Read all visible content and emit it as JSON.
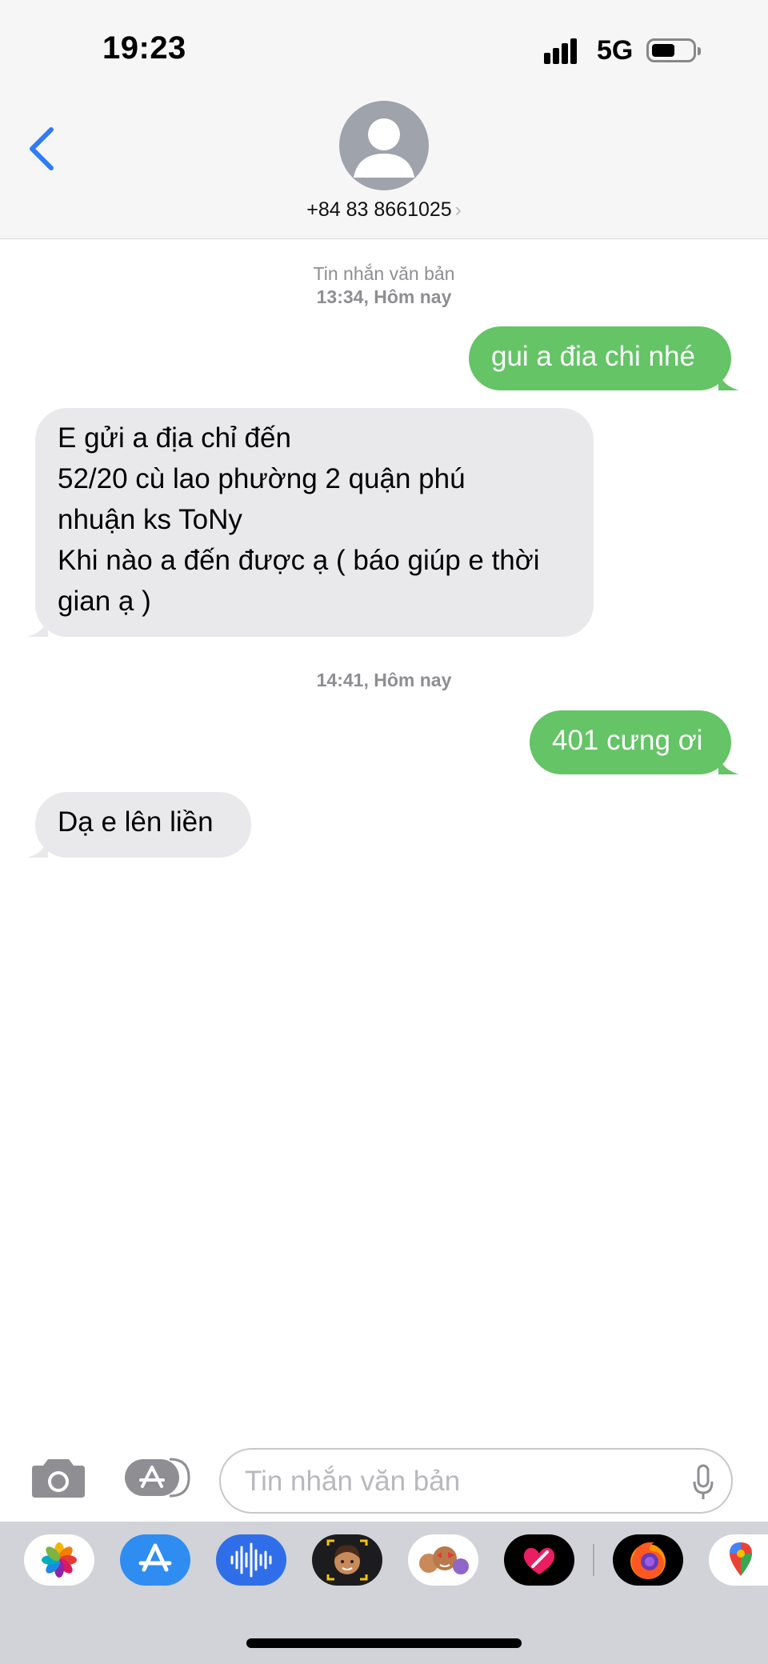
{
  "status_bar": {
    "time": "19:23",
    "network": "5G"
  },
  "header": {
    "contact_number": "+84 83 8661025",
    "contact_chevron": "›"
  },
  "conversation": {
    "header_label": "Tin nhắn văn bản",
    "timestamps": [
      {
        "time": "13:34,",
        "day": "Hôm nay"
      },
      {
        "time": "14:41,",
        "day": "Hôm nay"
      }
    ],
    "messages": [
      {
        "direction": "sent",
        "text": "gui a đia chi nhé"
      },
      {
        "direction": "received",
        "lines": [
          "E gửi a địa chỉ đến",
          "52/20 cù lao phường 2 quận phú",
          "nhuận ks ToNy",
          "Khi nào a đến được ạ ( báo giúp e thời",
          "gian ạ )"
        ]
      },
      {
        "direction": "sent",
        "text": "401 cưng ơi"
      },
      {
        "direction": "received",
        "text": "Dạ e lên liền"
      }
    ]
  },
  "composer": {
    "placeholder": "Tin nhắn văn bản"
  },
  "app_drawer": {
    "apps": [
      "photos-icon",
      "app-store-icon",
      "audio-message-icon",
      "memoji-icon",
      "memoji-stickers-icon",
      "digital-touch-icon",
      "firefox-icon",
      "google-maps-icon"
    ]
  },
  "colors": {
    "sent_bubble": "#64c466",
    "received_bubble": "#e9e9eb",
    "accent": "#2f7cf6"
  }
}
